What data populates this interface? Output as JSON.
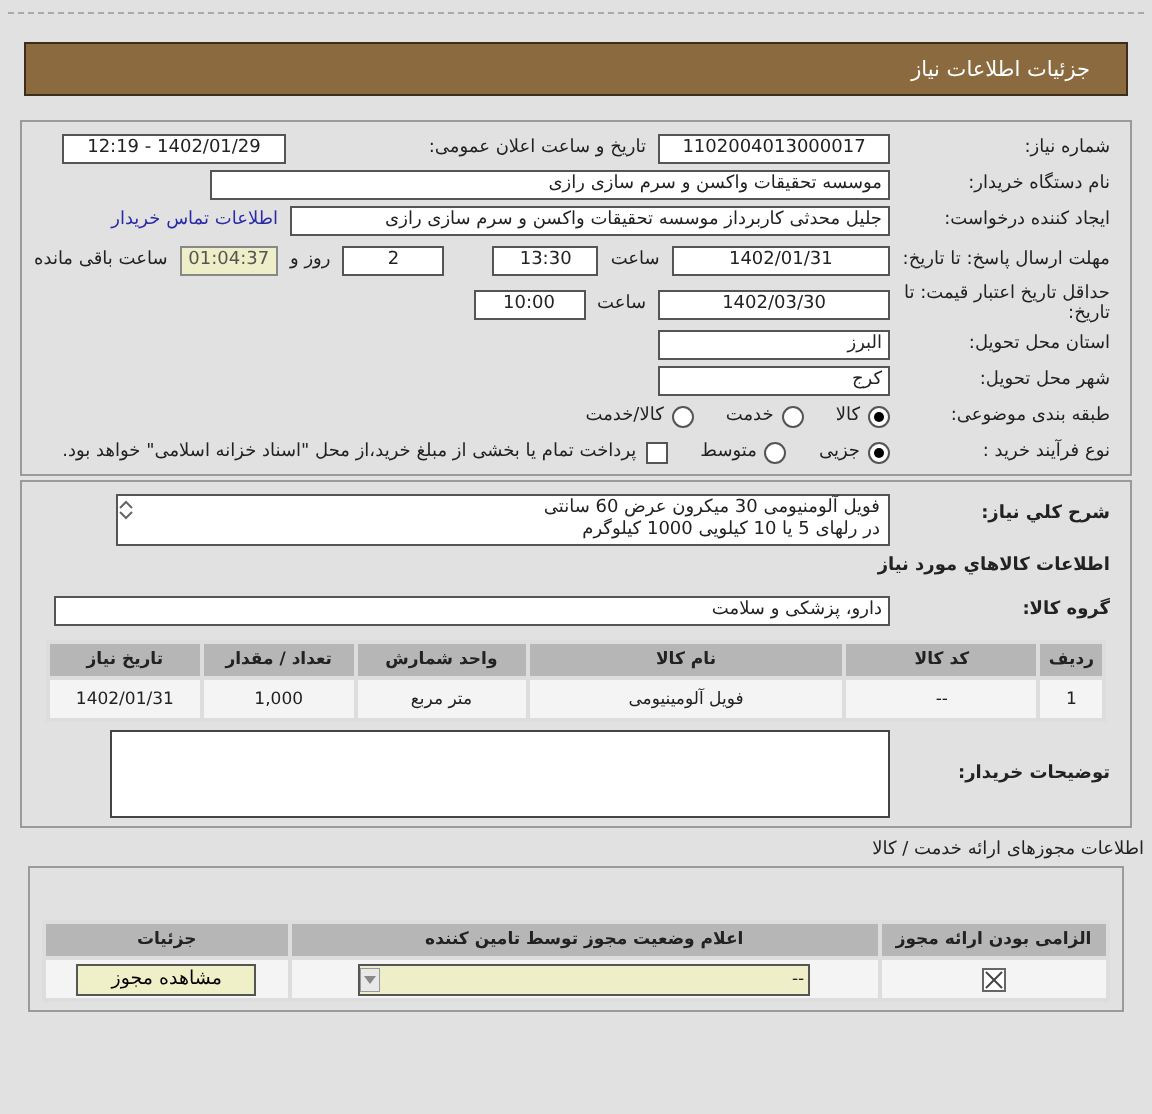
{
  "header": {
    "title": "جزئیات اطلاعات نیاز"
  },
  "need_number": {
    "label": "شماره نیاز:",
    "value": "1102004013000017"
  },
  "announce": {
    "label": "تاریخ و ساعت اعلان عمومی:",
    "value": "1402/01/29 - 12:19"
  },
  "buyer": {
    "label": "نام دستگاه خریدار:",
    "value": "موسسه تحقیقات واکسن و سرم سازی رازی"
  },
  "requester": {
    "label": "ایجاد کننده درخواست:",
    "value": "جلیل محدثی کاربرداز موسسه تحقیقات واکسن و سرم سازی رازی",
    "link": "اطلاعات تماس خریدار"
  },
  "deadline": {
    "label": "مهلت ارسال پاسخ: تا تاریخ:",
    "date": "1402/01/31",
    "time_label": "ساعت",
    "time": "13:30",
    "days": "2",
    "days_label": "روز و",
    "remaining": "01:04:37",
    "remaining_label": "ساعت باقی مانده"
  },
  "validity": {
    "label": "حداقل تاریخ اعتبار قیمت: تا تاریخ:",
    "date": "1402/03/30",
    "time_label": "ساعت",
    "time": "10:00"
  },
  "province": {
    "label": "استان محل تحویل:",
    "value": "البرز"
  },
  "city": {
    "label": "شهر محل تحویل:",
    "value": "کرج"
  },
  "category": {
    "label": "طبقه بندی موضوعی:",
    "options": [
      {
        "label": "کالا",
        "selected": true
      },
      {
        "label": "خدمت",
        "selected": false
      },
      {
        "label": "کالا/خدمت",
        "selected": false
      }
    ]
  },
  "process": {
    "label": "نوع فرآیند خرید :",
    "options": [
      {
        "label": "جزیی",
        "selected": true
      },
      {
        "label": "متوسط",
        "selected": false
      }
    ],
    "payment": {
      "label": "پرداخت تمام یا بخشی از مبلغ خرید،از محل \"اسناد خزانه اسلامی\" خواهد بود.",
      "checked": false
    }
  },
  "description": {
    "label": "شرح کلي نياز:",
    "lines": [
      "فویل آلومنیومی 30 میکرون عرض 60 سانتی",
      "در رلهای 5 یا 10 کیلویی 1000 کیلوگرم"
    ]
  },
  "items_heading": "اطلاعات کالاهاي مورد نياز",
  "goods_group": {
    "label": "گروه کالا:",
    "value": "دارو، پزشکی و سلامت"
  },
  "items_table": {
    "columns": [
      "ردیف",
      "کد کالا",
      "نام کالا",
      "واحد شمارش",
      "تعداد / مقدار",
      "تاریخ نیاز"
    ],
    "rows": [
      [
        "1",
        "--",
        "فویل آلومینیومی",
        "متر مربع",
        "1,000",
        "1402/01/31"
      ]
    ]
  },
  "buyer_notes": {
    "label": "توضیحات خریدار:"
  },
  "permits": {
    "heading": "اطلاعات مجوزهای ارائه خدمت / کالا",
    "columns": [
      "الزامی بودن ارائه مجوز",
      "اعلام وضعیت مجوز توسط تامین کننده",
      "جزئیات"
    ],
    "rows": [
      {
        "required": true,
        "status": "--",
        "button": "مشاهده مجوز"
      }
    ]
  }
}
